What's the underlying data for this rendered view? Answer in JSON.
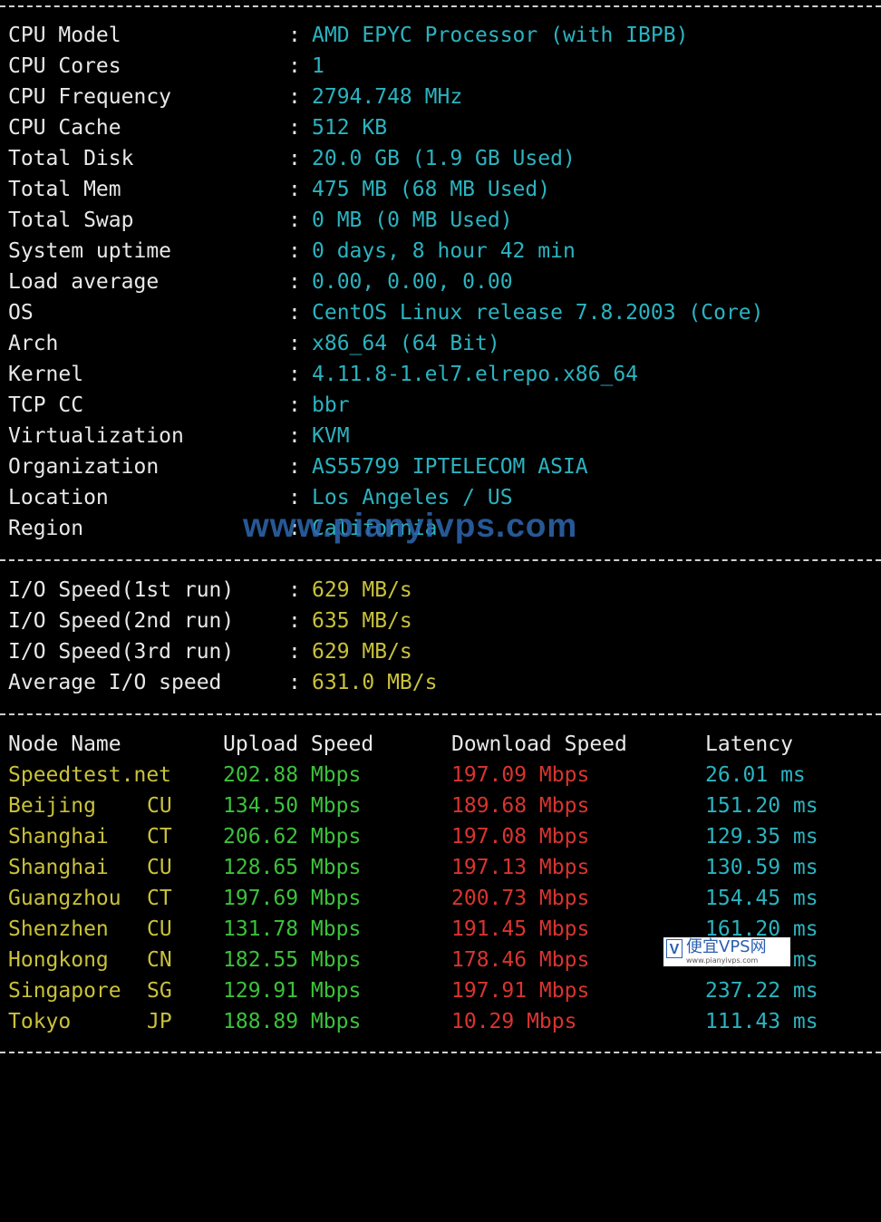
{
  "system_info": [
    {
      "label": "CPU Model",
      "value": "AMD EPYC Processor (with IBPB)"
    },
    {
      "label": "CPU Cores",
      "value": "1"
    },
    {
      "label": "CPU Frequency",
      "value": "2794.748 MHz"
    },
    {
      "label": "CPU Cache",
      "value": "512 KB"
    },
    {
      "label": "Total Disk",
      "value": "20.0 GB (1.9 GB Used)"
    },
    {
      "label": "Total Mem",
      "value": "475 MB (68 MB Used)"
    },
    {
      "label": "Total Swap",
      "value": "0 MB (0 MB Used)"
    },
    {
      "label": "System uptime",
      "value": "0 days, 8 hour 42 min"
    },
    {
      "label": "Load average",
      "value": "0.00, 0.00, 0.00"
    },
    {
      "label": "OS",
      "value": "CentOS Linux release 7.8.2003 (Core)"
    },
    {
      "label": "Arch",
      "value": "x86_64 (64 Bit)"
    },
    {
      "label": "Kernel",
      "value": "4.11.8-1.el7.elrepo.x86_64"
    },
    {
      "label": "TCP CC",
      "value": "bbr"
    },
    {
      "label": "Virtualization",
      "value": "KVM"
    },
    {
      "label": "Organization",
      "value": "AS55799 IPTELECOM ASIA"
    },
    {
      "label": "Location",
      "value": "Los Angeles / US"
    },
    {
      "label": "Region",
      "value": "California"
    }
  ],
  "separator": ":",
  "io_speed": [
    {
      "label": "I/O Speed(1st run)",
      "value": "629 MB/s"
    },
    {
      "label": "I/O Speed(2nd run)",
      "value": "635 MB/s"
    },
    {
      "label": "I/O Speed(3rd run)",
      "value": "629 MB/s"
    },
    {
      "label": "Average I/O speed",
      "value": "631.0 MB/s"
    }
  ],
  "speedtest": {
    "headers": {
      "node": "Node Name",
      "upload": "Upload Speed",
      "download": "Download Speed",
      "latency": "Latency"
    },
    "rows": [
      {
        "node": "Speedtest.net",
        "isp": "",
        "upload": "202.88 Mbps",
        "download": "197.09 Mbps",
        "latency": "26.01 ms"
      },
      {
        "node": "Beijing",
        "isp": "CU",
        "upload": "134.50 Mbps",
        "download": "189.68 Mbps",
        "latency": "151.20 ms"
      },
      {
        "node": "Shanghai",
        "isp": "CT",
        "upload": "206.62 Mbps",
        "download": "197.08 Mbps",
        "latency": "129.35 ms"
      },
      {
        "node": "Shanghai",
        "isp": "CU",
        "upload": "128.65 Mbps",
        "download": "197.13 Mbps",
        "latency": "130.59 ms"
      },
      {
        "node": "Guangzhou",
        "isp": "CT",
        "upload": "197.69 Mbps",
        "download": "200.73 Mbps",
        "latency": "154.45 ms"
      },
      {
        "node": "Shenzhen",
        "isp": "CU",
        "upload": "131.78 Mbps",
        "download": "191.45 Mbps",
        "latency": "161.20 ms"
      },
      {
        "node": "Hongkong",
        "isp": "CN",
        "upload": "182.55 Mbps",
        "download": "178.46 Mbps",
        "latency": "150.72 ms"
      },
      {
        "node": "Singapore",
        "isp": "SG",
        "upload": "129.91 Mbps",
        "download": "197.91 Mbps",
        "latency": "237.22 ms"
      },
      {
        "node": "Tokyo",
        "isp": "JP",
        "upload": "188.89 Mbps",
        "download": "10.29 Mbps",
        "latency": "111.43 ms"
      }
    ]
  },
  "watermark": {
    "text": "www.pianyivps.com"
  },
  "badge": {
    "mark": "V",
    "title": "便宜VPS网",
    "url": "www.pianyivps.com"
  },
  "colors": {
    "background": "#000000",
    "label": "#e8e8e8",
    "system_value": "#2bb3c0",
    "io_value": "#c9c13b",
    "node": "#c9c13b",
    "upload": "#3cc23c",
    "download": "#d9342f",
    "latency": "#2bb3c0",
    "watermark": "#2c64aa"
  }
}
